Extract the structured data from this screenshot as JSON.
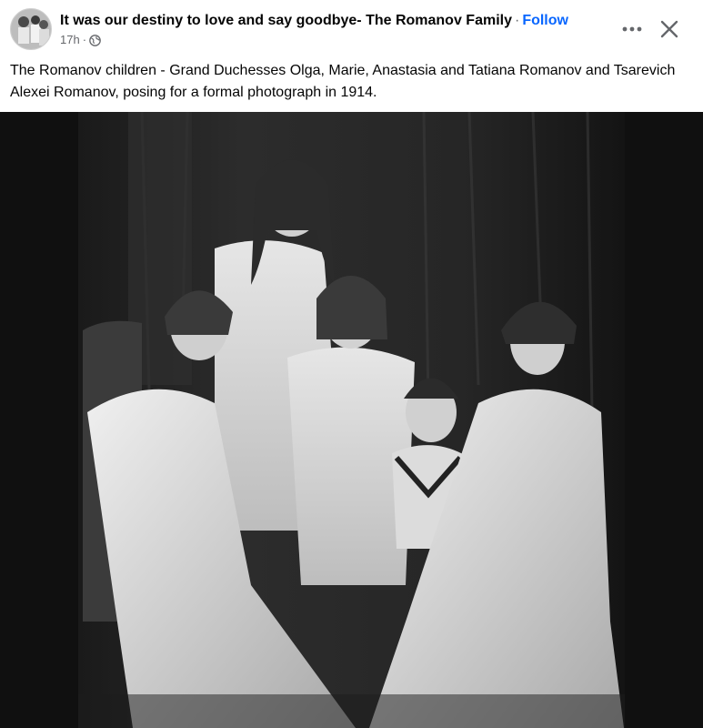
{
  "header": {
    "title": "It was our destiny to love and say goodbye- The Romanov Family",
    "separator": "·",
    "follow_label": "Follow",
    "time": "17h",
    "time_separator": "·",
    "icons": {
      "privacy": "globe-icon",
      "more": "more-horizontal-icon",
      "close": "close-icon"
    }
  },
  "post": {
    "caption": "The Romanov children - Grand Duchesses Olga, Marie, Anastasia and Tatiana Romanov and Tsarevich Alexei Romanov, posing for a formal photograph in 1914."
  },
  "colors": {
    "follow": "#0866ff",
    "secondary_text": "#65676b",
    "photo_backdrop": "#101010"
  }
}
